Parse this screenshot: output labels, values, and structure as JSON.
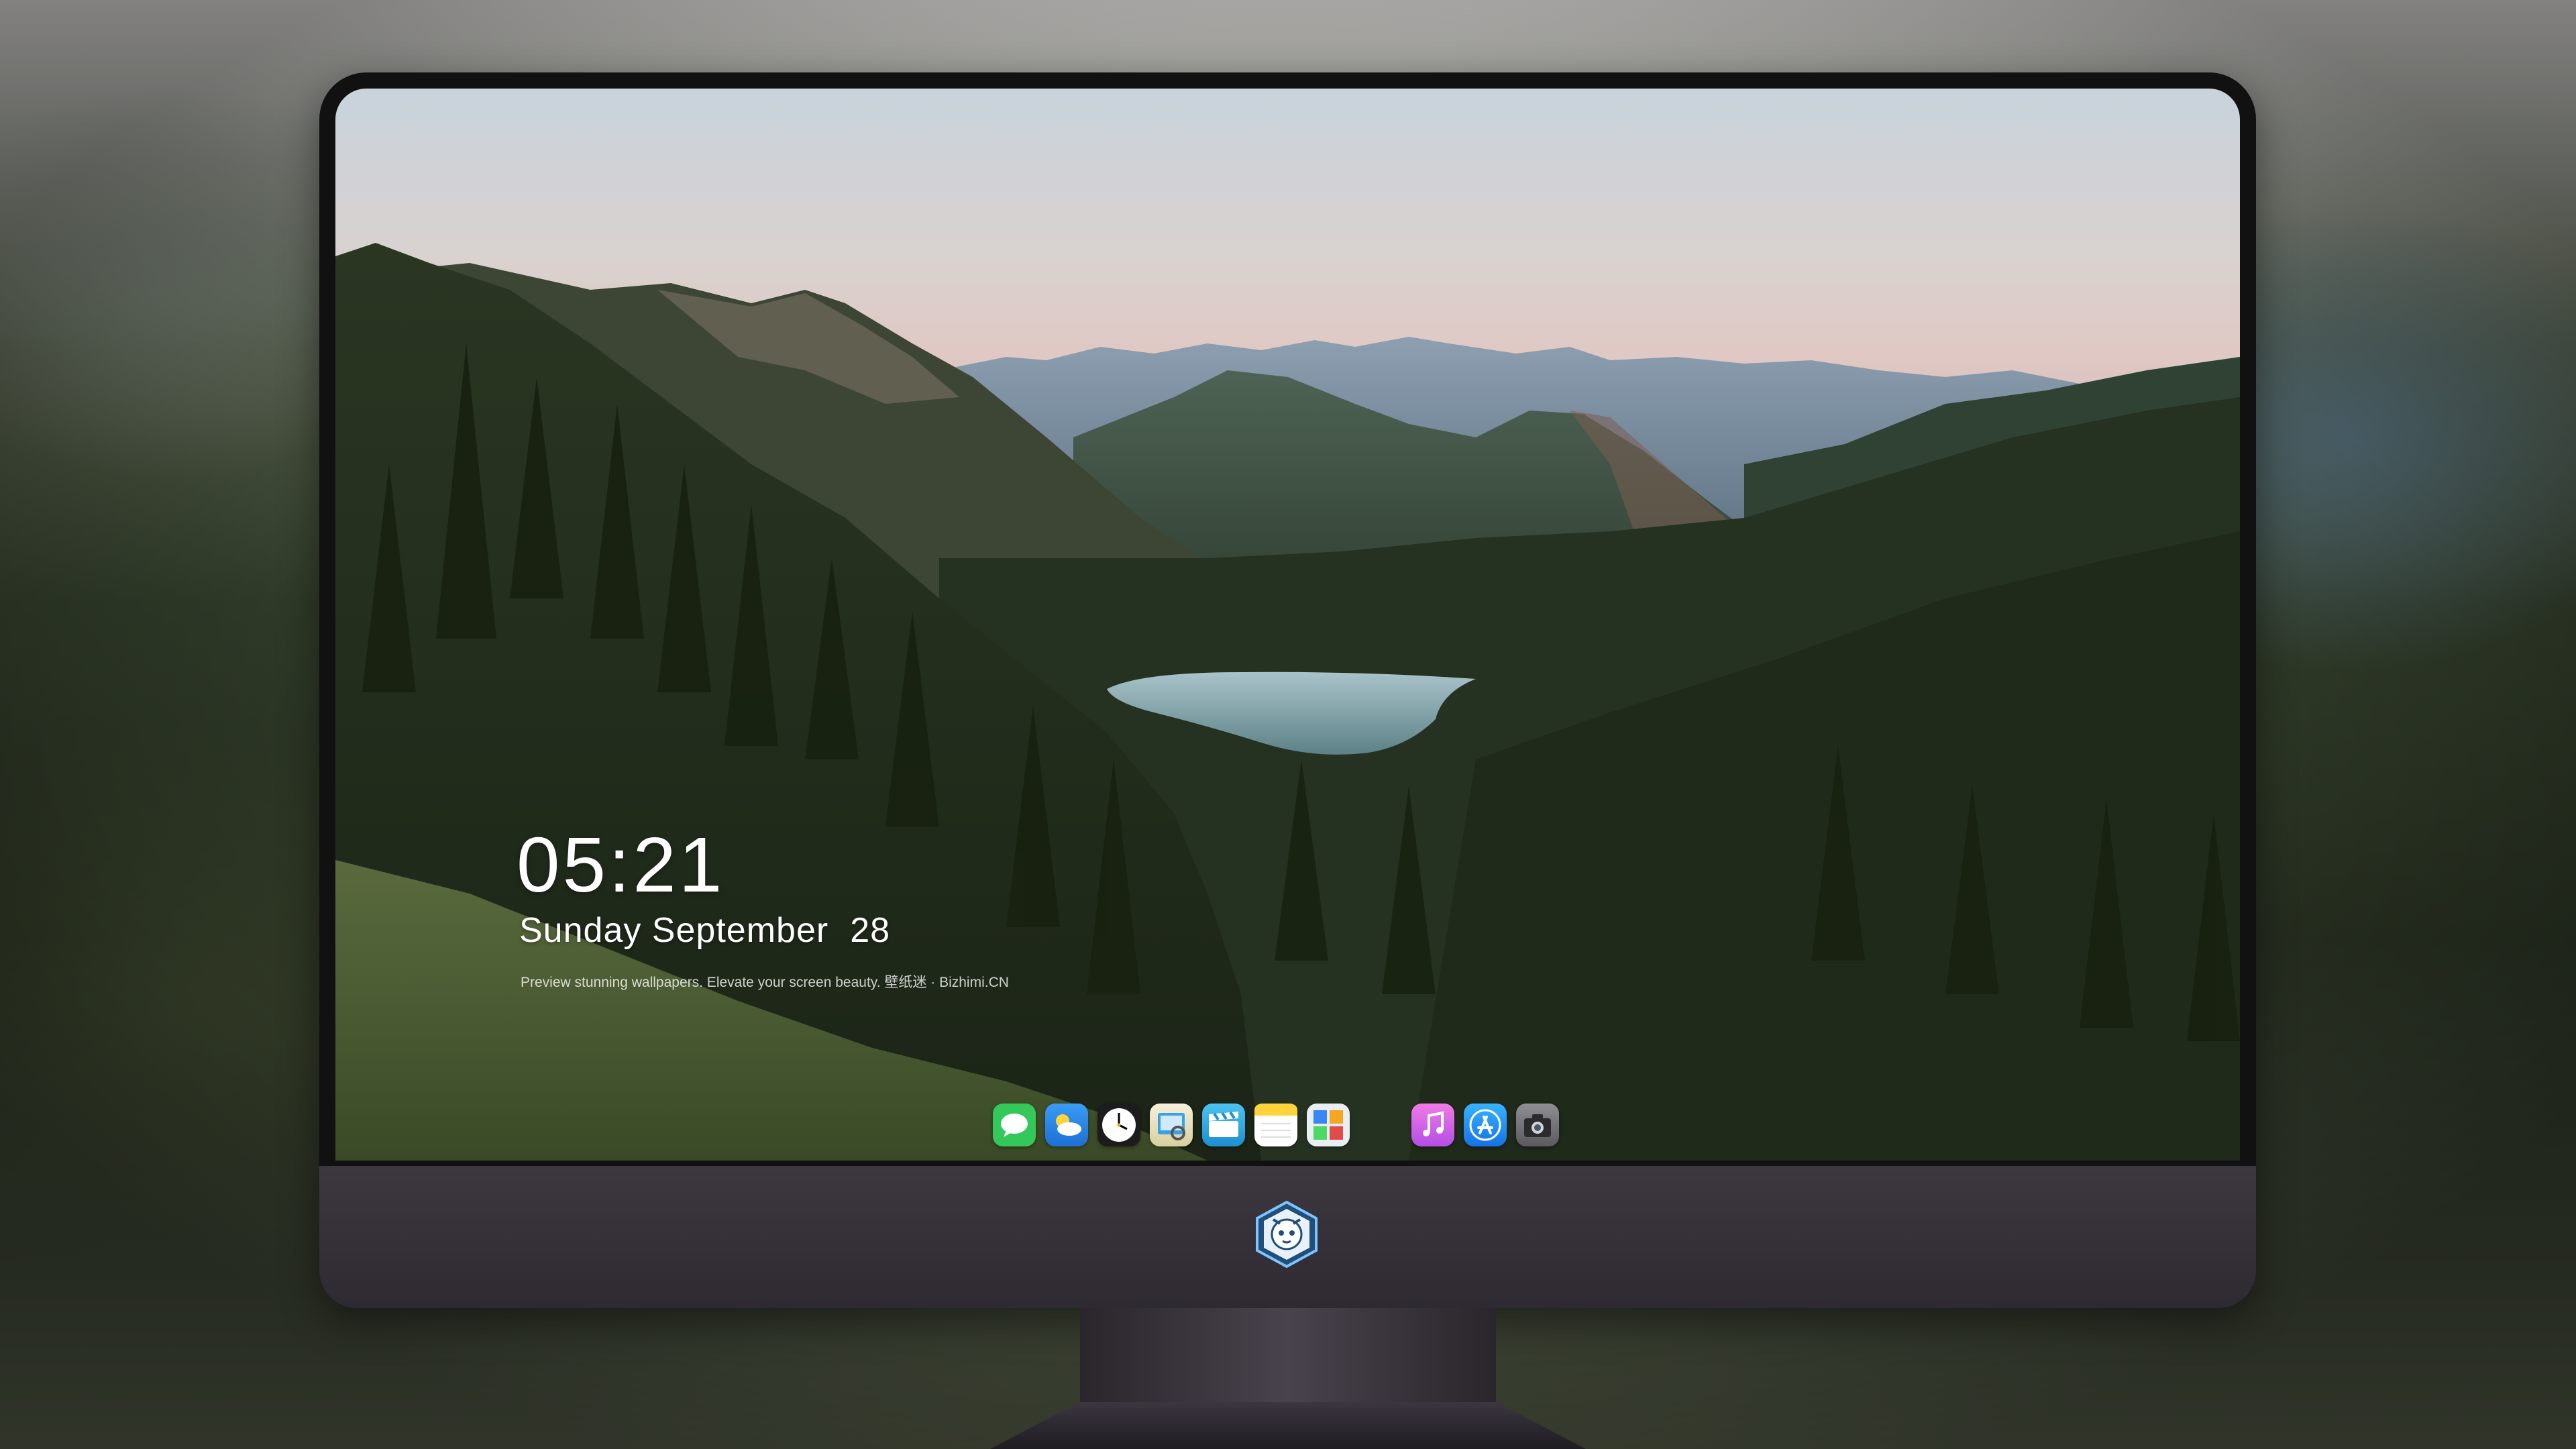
{
  "lockscreen": {
    "time": "05:21",
    "weekday_month": "Sunday September",
    "day": "28",
    "tagline": "Preview stunning wallpapers. Elevate your screen beauty. 壁纸迷 · Bizhimi.CN"
  },
  "dock": {
    "apps": [
      {
        "name": "messages",
        "icon": "messages-icon",
        "color": "#34c759"
      },
      {
        "name": "weather",
        "icon": "weather-icon",
        "color": "#2f8cf0"
      },
      {
        "name": "clock",
        "icon": "clock-icon",
        "color": "#1c1c1e"
      },
      {
        "name": "preview",
        "icon": "preview-icon",
        "color": "#3aa0e8"
      },
      {
        "name": "clips",
        "icon": "clips-icon",
        "color": "#30b0e0"
      },
      {
        "name": "notes",
        "icon": "notes-icon",
        "color": "#ffd43b"
      },
      {
        "name": "photo-booth",
        "icon": "photo-booth-icon",
        "color": "#e9eef2"
      },
      {
        "name": "itunes",
        "icon": "itunes-icon",
        "color": "#d455e6"
      },
      {
        "name": "app-store",
        "icon": "app-store-icon",
        "color": "#1e8cf5"
      },
      {
        "name": "camera",
        "icon": "camera-icon",
        "color": "#6c6c70"
      }
    ]
  },
  "monitor": {
    "logo": "mascot-logo-icon"
  }
}
